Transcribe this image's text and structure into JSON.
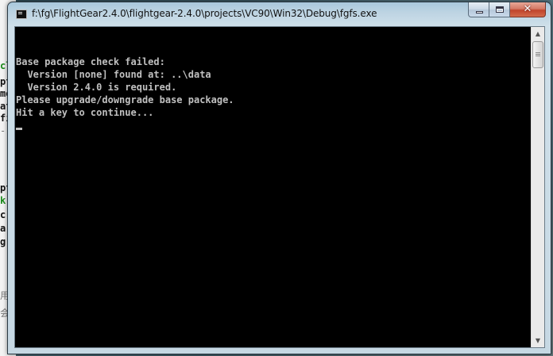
{
  "window": {
    "title": "f:\\fg\\FlightGear2.4.0\\flightgear-2.4.0\\projects\\VC90\\Win32\\Debug\\fgfs.exe",
    "buttons": {
      "minimize": "minimize-icon",
      "maximize": "maximize-icon",
      "close": "✕"
    }
  },
  "console": {
    "lines": [
      "Base package check failed:",
      "  Version [none] found at: ..\\data",
      "  Version 2.4.0 is required.",
      "Please upgrade/downgrade base package.",
      "Hit a key to continue..."
    ],
    "text_color": "#c0c0c0",
    "background": "#000000"
  },
  "background_window": {
    "fragments": [
      {
        "text": "cl",
        "color": "green"
      },
      {
        "text": "pt",
        "color": "dark"
      },
      {
        "text": "me",
        "color": "dark"
      },
      {
        "text": "at",
        "color": "dark"
      },
      {
        "text": "fi",
        "color": "dark"
      },
      {
        "text": "-",
        "color": "grey"
      },
      {
        "text": "pt",
        "color": "dark"
      },
      {
        "text": "k",
        "color": "green"
      },
      {
        "text": "c",
        "color": "dark"
      },
      {
        "text": "a",
        "color": "dark"
      },
      {
        "text": "g",
        "color": "dark"
      },
      {
        "text": "用",
        "color": "grey"
      },
      {
        "text": "会",
        "color": "grey"
      }
    ]
  }
}
